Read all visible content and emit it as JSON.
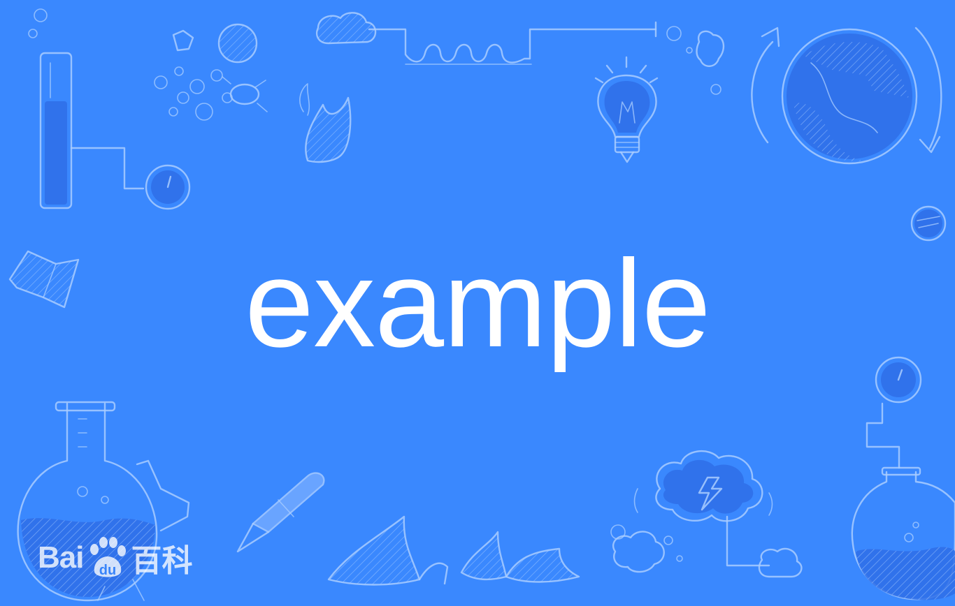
{
  "main": {
    "title": "example"
  },
  "watermark": {
    "brand_latin": "Bai",
    "brand_du": "du",
    "brand_cn": "百科"
  },
  "colors": {
    "background": "#3a88fe",
    "doodle_stroke": "#a9cdff",
    "text": "#ffffff"
  },
  "icons": [
    "test-tube-icon",
    "gauge-icon",
    "cells-icon",
    "flame-icon",
    "cloud-icon",
    "coil-tube-icon",
    "lightbulb-icon",
    "globe-icon",
    "planet-icon",
    "open-book-icon",
    "flask-icon",
    "pen-icon",
    "leaf-icon",
    "thought-cloud-icon",
    "round-flask-icon"
  ]
}
